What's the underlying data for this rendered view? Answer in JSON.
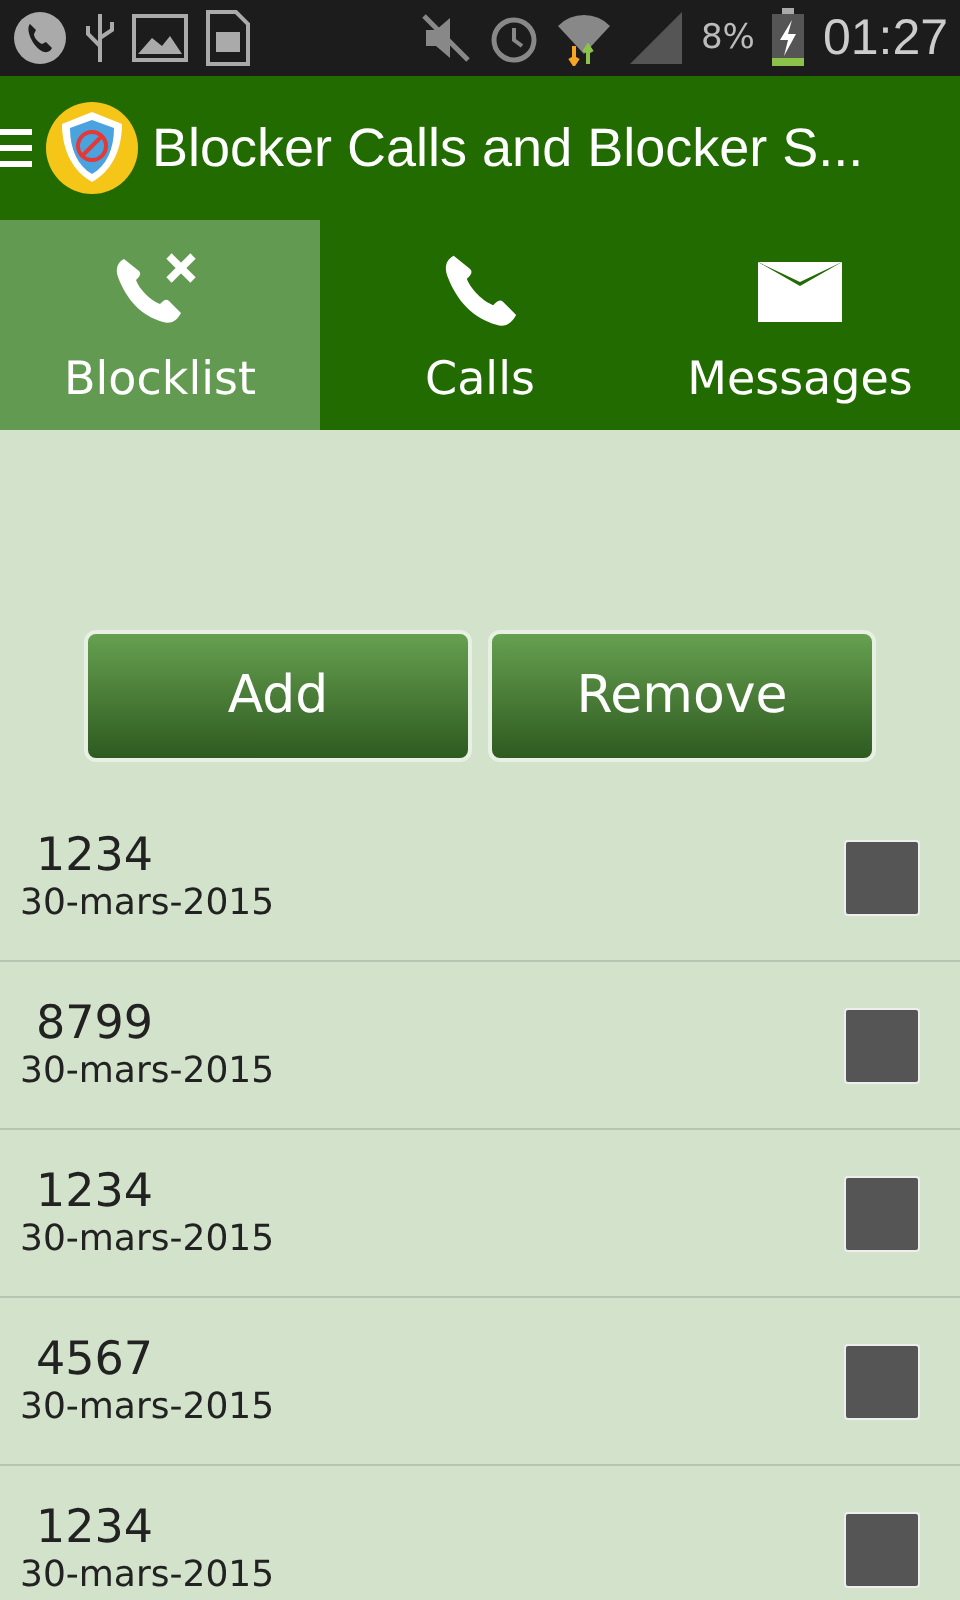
{
  "status_bar": {
    "battery": "8%",
    "time": "01:27"
  },
  "app_bar": {
    "title": "Blocker Calls and Blocker S..."
  },
  "tabs": [
    {
      "label": "Blocklist",
      "selected": true
    },
    {
      "label": "Calls",
      "selected": false
    },
    {
      "label": "Messages",
      "selected": false
    }
  ],
  "buttons": [
    "Add",
    "Remove"
  ],
  "entries": [
    {
      "number": "1234",
      "date": "30-mars-2015",
      "checked": false
    },
    {
      "number": "8799",
      "date": "30-mars-2015",
      "checked": false
    },
    {
      "number": "1234",
      "date": "30-mars-2015",
      "checked": false
    },
    {
      "number": "4567",
      "date": "30-mars-2015",
      "checked": false
    },
    {
      "number": "1234",
      "date": "30-mars-2015",
      "checked": false
    }
  ]
}
